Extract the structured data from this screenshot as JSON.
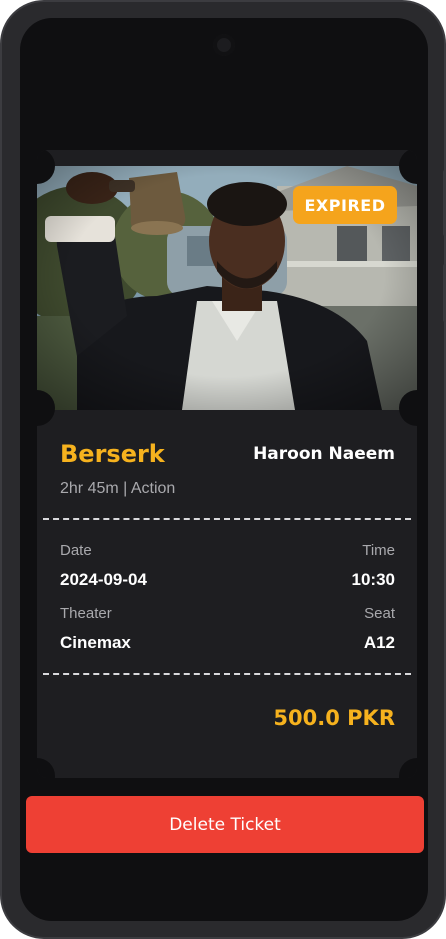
{
  "ticket": {
    "status_badge": "EXPIRED",
    "movie_title": "Berserk",
    "user_name": "Haroon Naeem",
    "meta": "2hr 45m | Action",
    "date_label": "Date",
    "date_value": "2024-09-04",
    "time_label": "Time",
    "time_value": "10:30",
    "theater_label": "Theater",
    "theater_value": "Cinemax",
    "seat_label": "Seat",
    "seat_value": "A12",
    "price": "500.0 PKR"
  },
  "actions": {
    "delete_label": "Delete Ticket"
  },
  "colors": {
    "accent_yellow": "#f6b21e",
    "badge_orange": "#f5a41c",
    "delete_red": "#ee4034",
    "background": "#0f0f11",
    "card": "#1e1e21"
  }
}
